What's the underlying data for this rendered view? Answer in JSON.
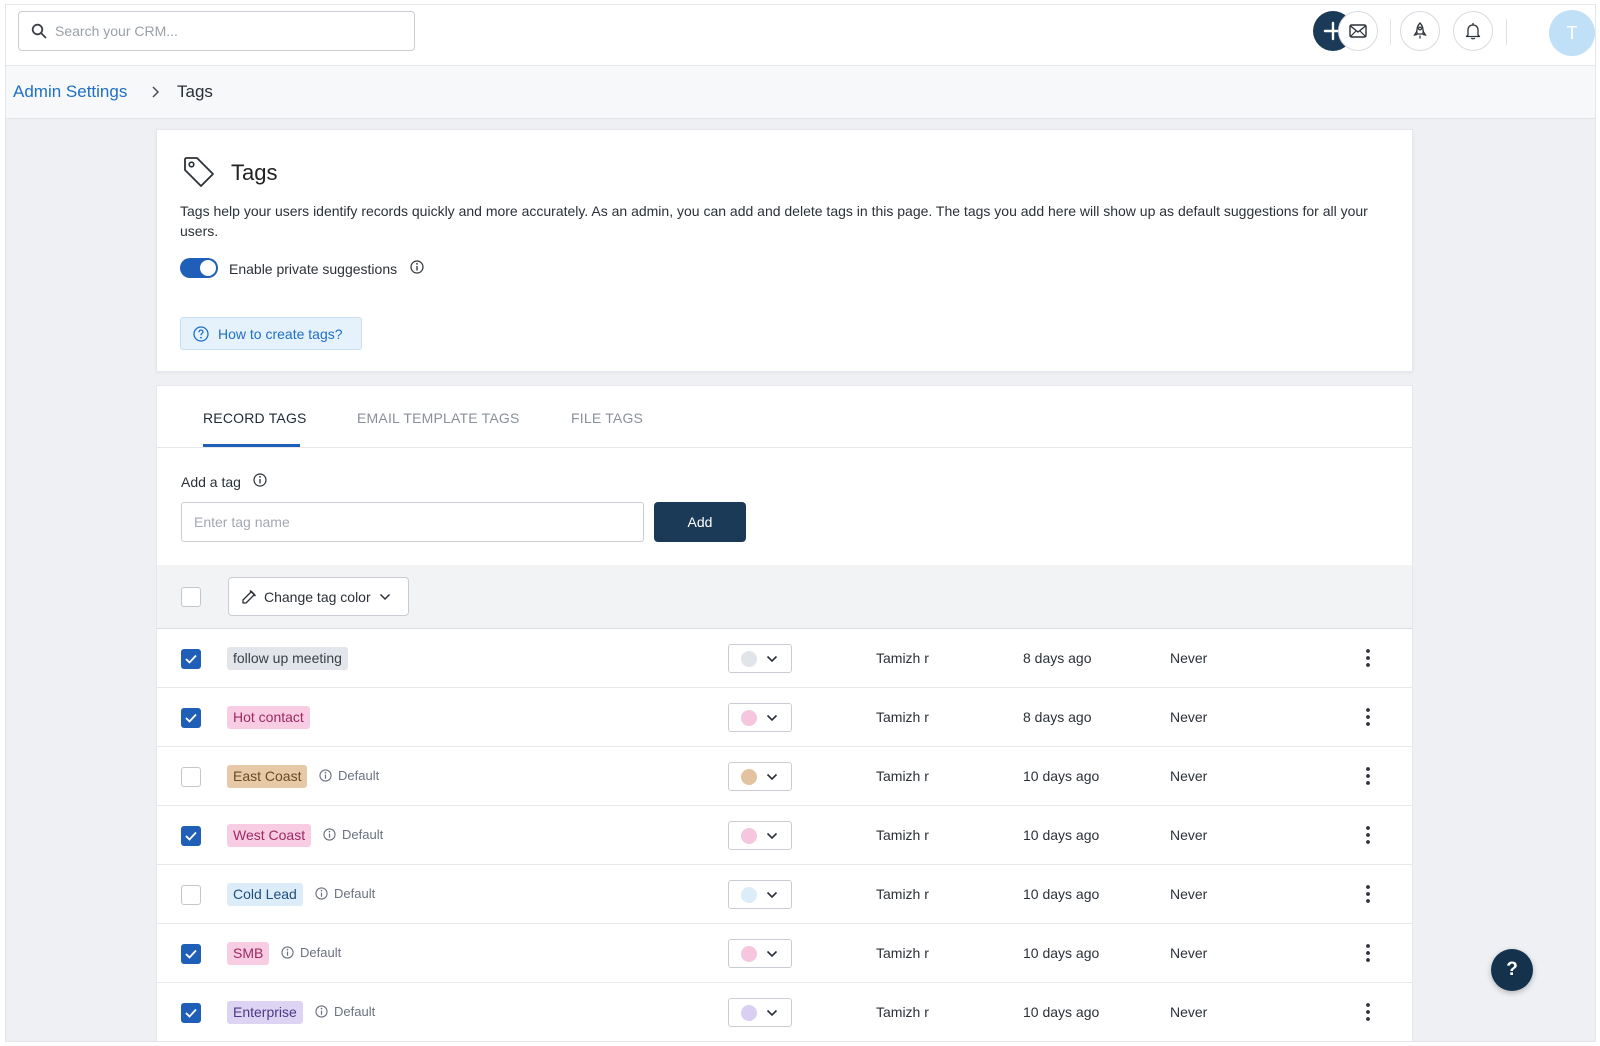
{
  "search": {
    "placeholder": "Search your CRM..."
  },
  "breadcrumb": {
    "parent": "Admin Settings",
    "current": "Tags"
  },
  "header": {
    "title": "Tags",
    "description": "Tags help your users identify records quickly and more accurately. As an admin, you can add and delete tags in this page. The tags you add here will show up as default suggestions for all your users.",
    "toggle_label": "Enable private suggestions",
    "toggle_on": true,
    "help_link": "How to create tags?"
  },
  "tabs": [
    {
      "label": "RECORD TAGS",
      "active": true
    },
    {
      "label": "EMAIL TEMPLATE TAGS",
      "active": false
    },
    {
      "label": "FILE TAGS",
      "active": false
    }
  ],
  "add_tag": {
    "label": "Add a tag",
    "placeholder": "Enter tag name",
    "button": "Add"
  },
  "bulk": {
    "change_color_label": "Change tag color"
  },
  "colors": {
    "brand": "#1b3a57",
    "accent": "#1f5fb8",
    "link": "#1f6fc5"
  },
  "rows": [
    {
      "name": "follow up meeting",
      "default": "",
      "checked": true,
      "chip_bg": "#e2e5e9",
      "chip_fg": "#3b4048",
      "dot": "#e1e4e8",
      "owner": "Tamizh r",
      "created": "8 days ago",
      "last_used": "Never"
    },
    {
      "name": "Hot contact",
      "default": "",
      "checked": true,
      "chip_bg": "#f8cde4",
      "chip_fg": "#9c2a62",
      "dot": "#f6c6df",
      "owner": "Tamizh r",
      "created": "8 days ago",
      "last_used": "Never"
    },
    {
      "name": "East Coast",
      "default": "Default",
      "checked": false,
      "chip_bg": "#e6c9a6",
      "chip_fg": "#6b4a25",
      "dot": "#e3c39f",
      "owner": "Tamizh r",
      "created": "10 days ago",
      "last_used": "Never"
    },
    {
      "name": "West Coast",
      "default": "Default",
      "checked": true,
      "chip_bg": "#f8cde4",
      "chip_fg": "#9c2a62",
      "dot": "#f6c6df",
      "owner": "Tamizh r",
      "created": "10 days ago",
      "last_used": "Never"
    },
    {
      "name": "Cold Lead",
      "default": "Default",
      "checked": false,
      "chip_bg": "#dcecf9",
      "chip_fg": "#1f4f7a",
      "dot": "#dcecf9",
      "owner": "Tamizh r",
      "created": "10 days ago",
      "last_used": "Never"
    },
    {
      "name": "SMB",
      "default": "Default",
      "checked": true,
      "chip_bg": "#f8cde4",
      "chip_fg": "#9c2a62",
      "dot": "#f6c6df",
      "owner": "Tamizh r",
      "created": "10 days ago",
      "last_used": "Never"
    },
    {
      "name": "Enterprise",
      "default": "Default",
      "checked": true,
      "chip_bg": "#ddd3f3",
      "chip_fg": "#4b3a86",
      "dot": "#d9cff2",
      "owner": "Tamizh r",
      "created": "10 days ago",
      "last_used": "Never"
    }
  ],
  "user": {
    "initial": "T"
  },
  "help": {
    "label": "?"
  }
}
